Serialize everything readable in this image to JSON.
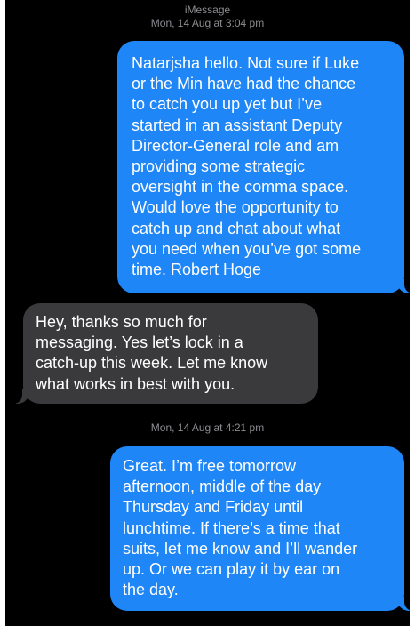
{
  "header": {
    "service": "iMessage",
    "timestamp": "Mon, 14 Aug at 3:04 pm"
  },
  "messages": [
    {
      "direction": "sent",
      "lines": [
        "Natarjsha hello. Not sure if Luke",
        "or the Min have had the chance",
        "to catch you up yet but I’ve",
        "started in an assistant Deputy",
        "Director-General role and am",
        "providing some strategic",
        "oversight in the comma space.",
        "Would love the opportunity to",
        "catch up and chat about what",
        "you need when you’ve got some",
        "time. Robert Hoge"
      ]
    },
    {
      "direction": "received",
      "lines": [
        "Hey, thanks so much for",
        "messaging. Yes let’s lock in a",
        "catch-up this week. Let me know",
        "what works in best with you."
      ]
    },
    {
      "direction": "sent",
      "lines": [
        "Great. I’m free tomorrow",
        "afternoon, middle of the day",
        "Thursday and Friday until",
        "lunchtime. If there’s a time that",
        "suits, let me know and I’ll wander",
        "up. Or we can play it by ear on",
        "the day."
      ]
    }
  ],
  "second_timestamp": "Mon, 14 Aug at 4:21 pm",
  "colors": {
    "background": "#000000",
    "sent_bubble": "#1f86f7",
    "received_bubble": "#3a3a3c",
    "meta_text": "#8e8e93",
    "bubble_text": "#ffffff"
  }
}
